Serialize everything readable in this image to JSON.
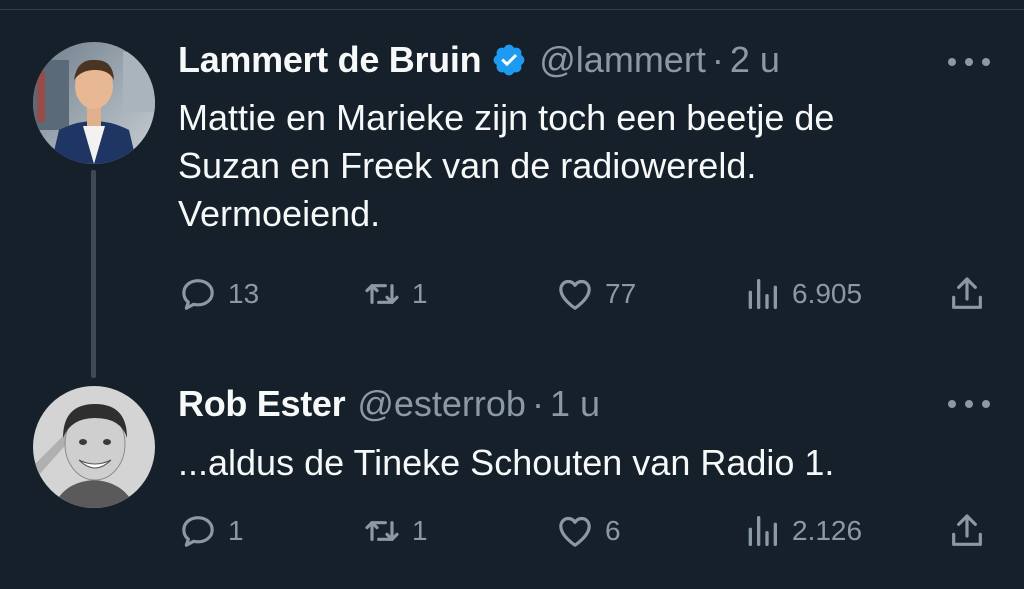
{
  "colors": {
    "background": "#15202b",
    "text_primary": "#f7f9f9",
    "text_secondary": "#8b98a5",
    "verified": "#1d9bf0",
    "thread_line": "#3d4a55"
  },
  "tweets": [
    {
      "name": "Lammert de Bruin",
      "verified": true,
      "handle": "@lammert",
      "separator": "·",
      "time": "2 u",
      "text": "Mattie en Marieke zijn toch een beetje de\nSuzan en Freek van de radiowereld.\nVermoeiend.",
      "replies": "13",
      "retweets": "1",
      "likes": "77",
      "views": "6.905"
    },
    {
      "name": "Rob Ester",
      "verified": false,
      "handle": "@esterrob",
      "separator": "·",
      "time": "1 u",
      "text": "...aldus de Tineke Schouten van Radio 1.",
      "replies": "1",
      "retweets": "1",
      "likes": "6",
      "views": "2.126"
    }
  ],
  "icons": {
    "more": "more-dots-icon",
    "reply": "reply-icon",
    "retweet": "retweet-icon",
    "like": "heart-icon",
    "views": "views-bar-chart-icon",
    "share": "share-icon",
    "verified": "verified-badge-icon"
  }
}
